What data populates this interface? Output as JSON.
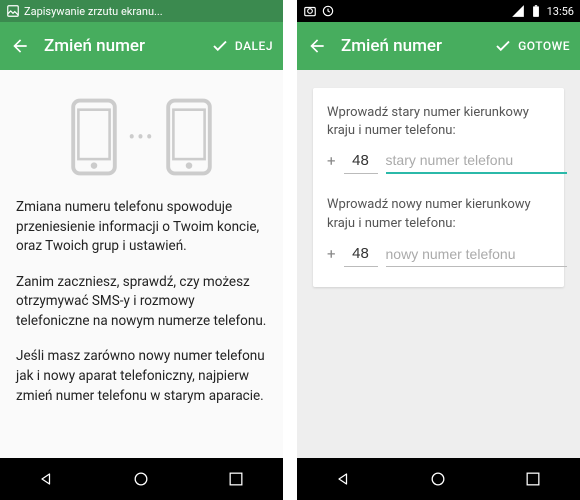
{
  "left": {
    "status": {
      "text": "Zapisywanie zrzutu ekranu..."
    },
    "appbar": {
      "title": "Zmień numer",
      "action": "DALEJ"
    },
    "paragraphs": [
      "Zmiana numeru telefonu spowoduje przeniesienie informacji o Twoim koncie, oraz Twoich grup i ustawień.",
      "Zanim zaczniesz, sprawdź, czy możesz otrzymywać SMS-y i rozmowy telefoniczne na nowym numerze telefonu.",
      "Jeśli masz zarówno nowy numer telefonu jak i nowy aparat telefoniczny, najpierw zmień numer telefonu w starym aparacie."
    ]
  },
  "right": {
    "status": {
      "time": "13:56"
    },
    "appbar": {
      "title": "Zmień numer",
      "action": "GOTOWE"
    },
    "form": {
      "old": {
        "label": "Wprowadź stary numer kierunkowy kraju i numer telefonu:",
        "cc": "48",
        "placeholder": "stary numer telefonu"
      },
      "new": {
        "label": "Wprowadź nowy numer kierunkowy kraju i numer telefonu:",
        "cc": "48",
        "placeholder": "nowy numer telefonu"
      }
    }
  },
  "colors": {
    "accent": "#47ad5e",
    "teal": "#2bb9a9"
  }
}
